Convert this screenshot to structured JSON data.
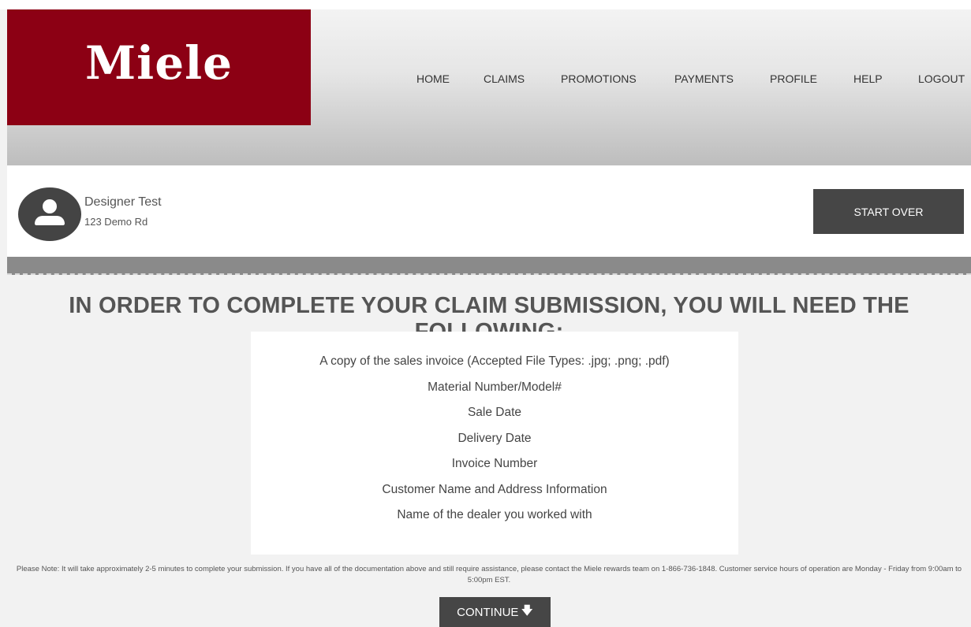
{
  "header": {
    "logo_text": "Miele",
    "nav": [
      {
        "label": "HOME"
      },
      {
        "label": "CLAIMS"
      },
      {
        "label": "PROMOTIONS"
      },
      {
        "label": "PAYMENTS"
      },
      {
        "label": "PROFILE"
      },
      {
        "label": "HELP"
      },
      {
        "label": "LOGOUT"
      }
    ]
  },
  "user": {
    "name": "Designer Test",
    "address": "123 Demo Rd",
    "avatar_icon": "user-avatar-icon"
  },
  "start_over_label": "START OVER",
  "main": {
    "heading": "IN ORDER TO COMPLETE YOUR CLAIM SUBMISSION, YOU WILL NEED THE FOLLOWING:",
    "requirements": [
      "A copy of the sales invoice (Accepted File Types: .jpg; .png; .pdf)",
      "Material Number/Model#",
      "Sale Date",
      "Delivery Date",
      "Invoice Number",
      "Customer Name and Address Information",
      "Name of the dealer you worked with"
    ],
    "note": "Please Note: It will take approximately 2-5 minutes to complete your submission. If you have all of the documentation above and still require assistance, please contact the Miele rewards team on 1-866-736-1848. Customer service hours of operation are Monday - Friday from 9:00am to 5:00pm EST.",
    "continue_label": "CONTINUE",
    "continue_icon": "arrow-down-icon"
  },
  "colors": {
    "brand": "#8c0014",
    "button": "#464646",
    "band": "#8a8a8a"
  }
}
